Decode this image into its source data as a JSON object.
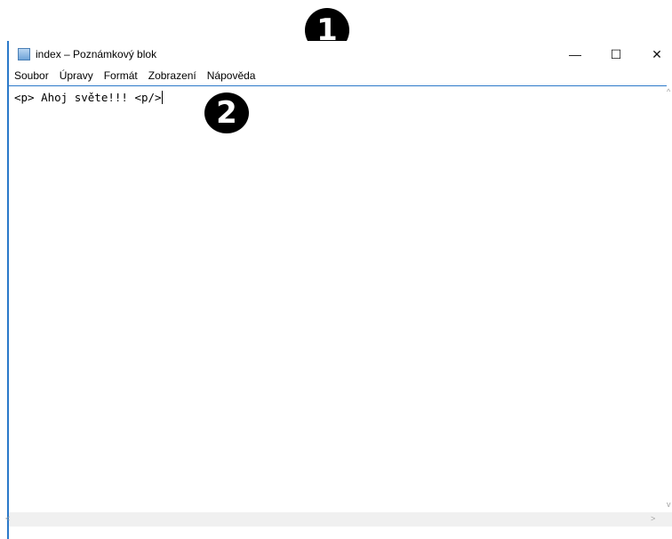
{
  "markers": {
    "one": "1",
    "two": "2"
  },
  "window": {
    "title": "index – Poznámkový blok",
    "controls": {
      "minimize": "—",
      "maximize": "☐",
      "close": "✕"
    }
  },
  "menu": {
    "items": [
      "Soubor",
      "Úpravy",
      "Formát",
      "Zobrazení",
      "Nápověda"
    ]
  },
  "editor": {
    "content": "<p> Ahoj světe!!! <p/>"
  },
  "scrollbars": {
    "up": "^",
    "down": "v",
    "left": "<",
    "right": ">"
  }
}
